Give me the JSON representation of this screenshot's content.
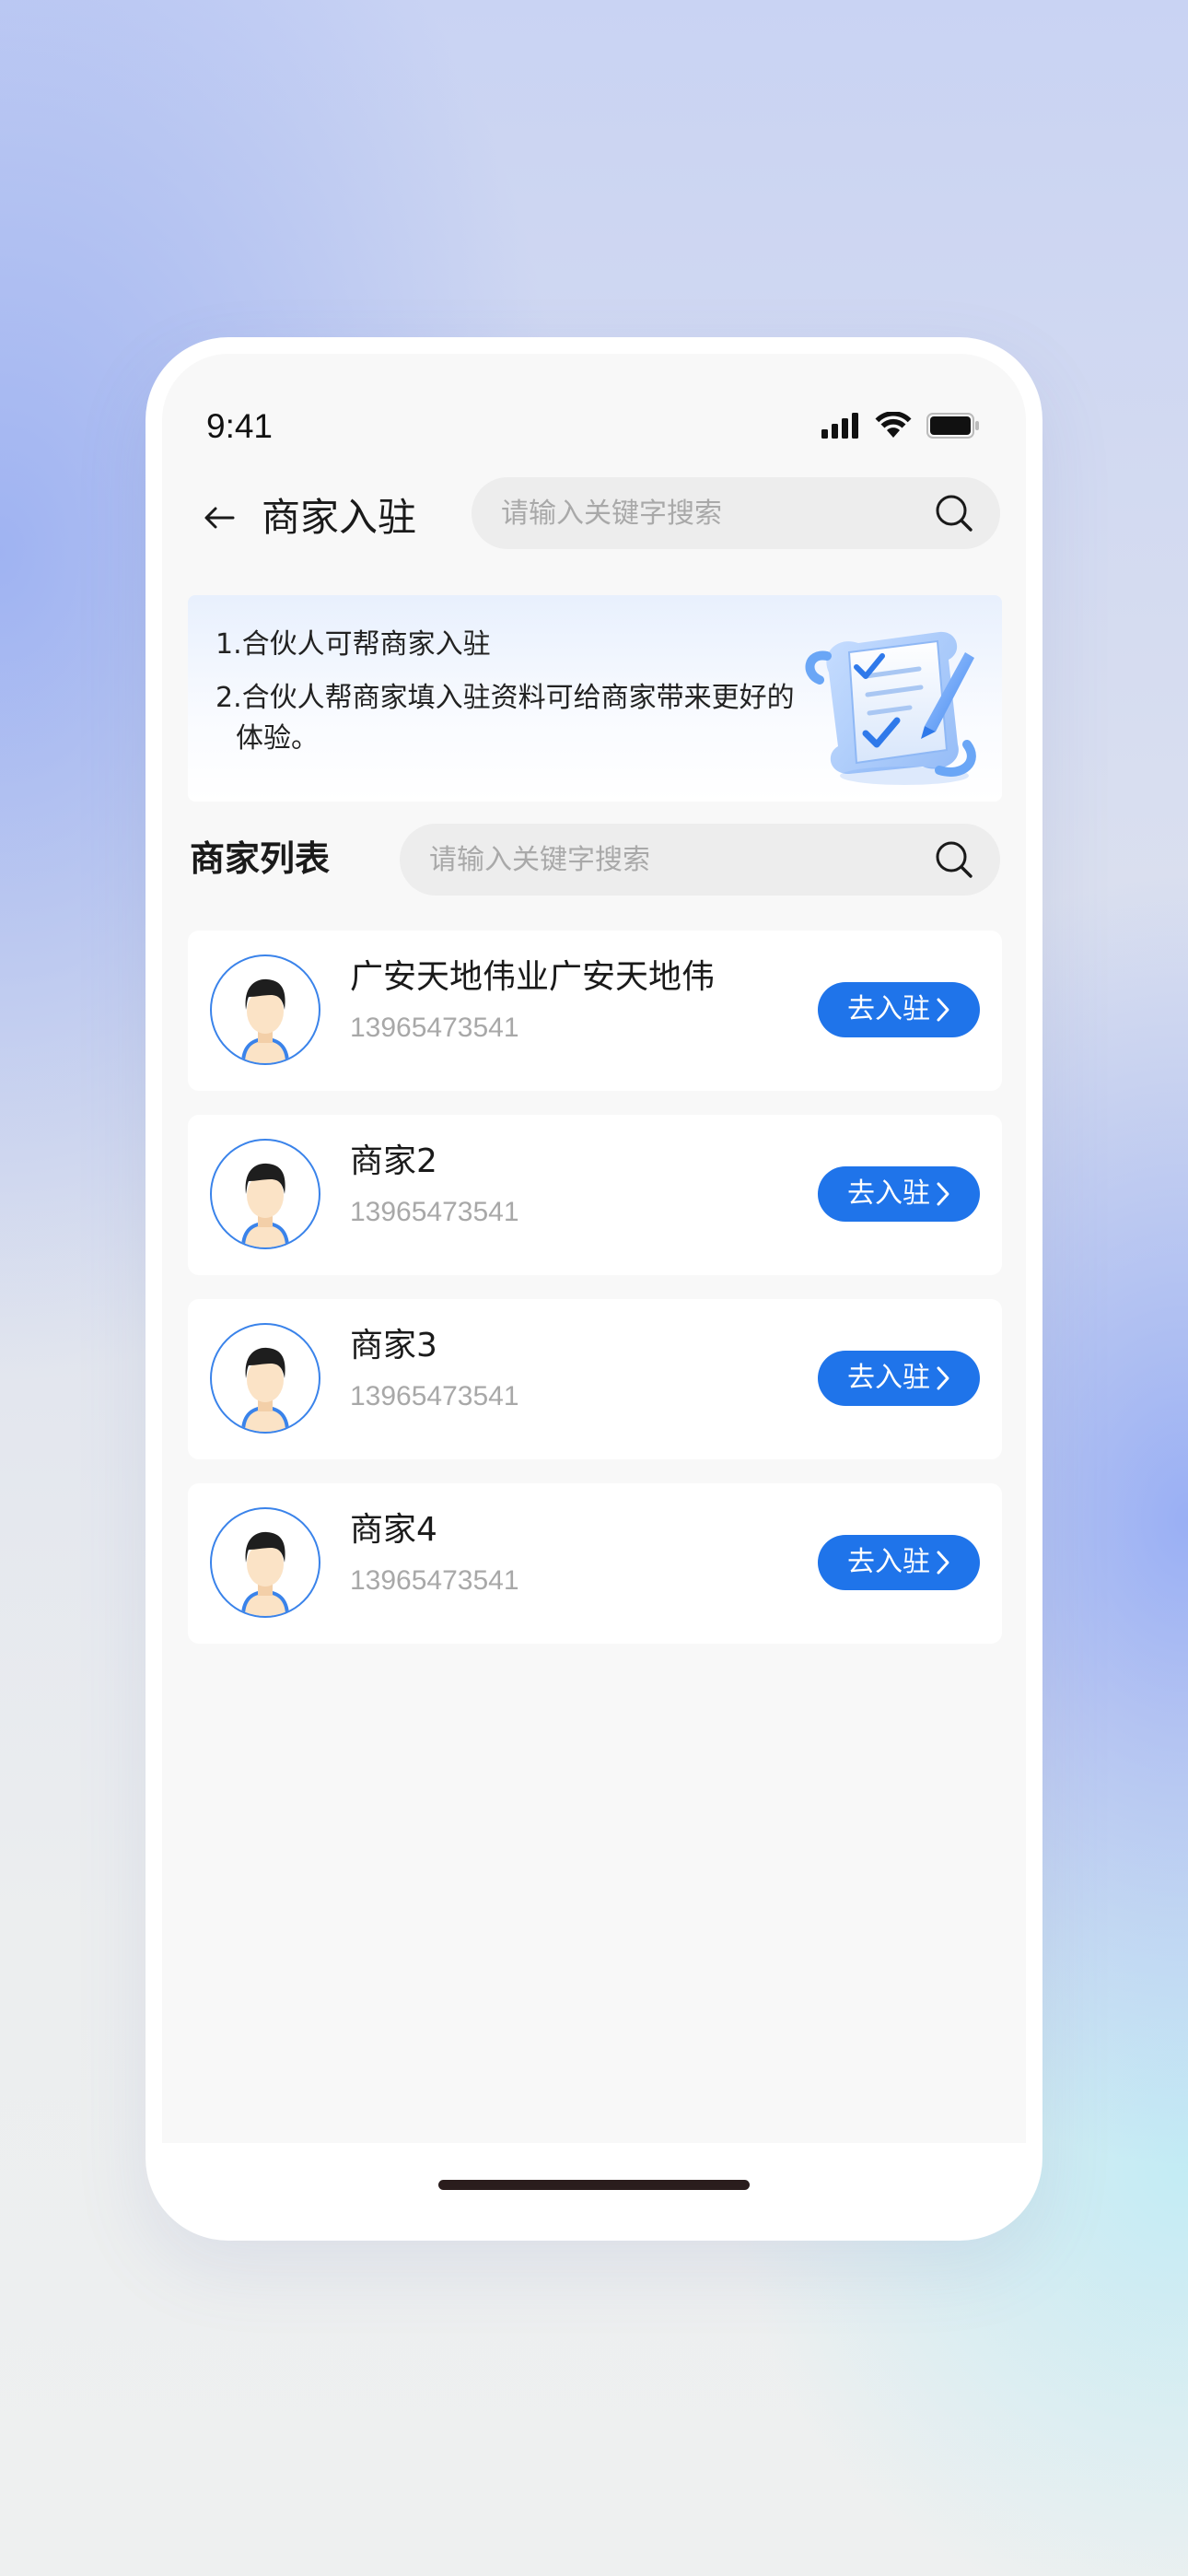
{
  "status_bar": {
    "time": "9:41"
  },
  "header": {
    "title": "商家入驻",
    "search_placeholder": "请输入关键字搜索"
  },
  "info": {
    "line1": "1.合伙人可帮商家入驻",
    "line2_number": "2.",
    "line2_text": "合伙人帮商家填入驻资料可给商家带来更好的体验。"
  },
  "list": {
    "title": "商家列表",
    "search_placeholder": "请输入关键字搜索",
    "merchants": [
      {
        "name": "广安天地伟业广安天地伟",
        "phone": "13965473541",
        "action": "去入驻"
      },
      {
        "name": "商家2",
        "phone": "13965473541",
        "action": "去入驻"
      },
      {
        "name": "商家3",
        "phone": "13965473541",
        "action": "去入驻"
      },
      {
        "name": "商家4",
        "phone": "13965473541",
        "action": "去入驻"
      }
    ]
  },
  "colors": {
    "accent": "#1f74ea",
    "avatar_ring": "#3a83ea"
  }
}
